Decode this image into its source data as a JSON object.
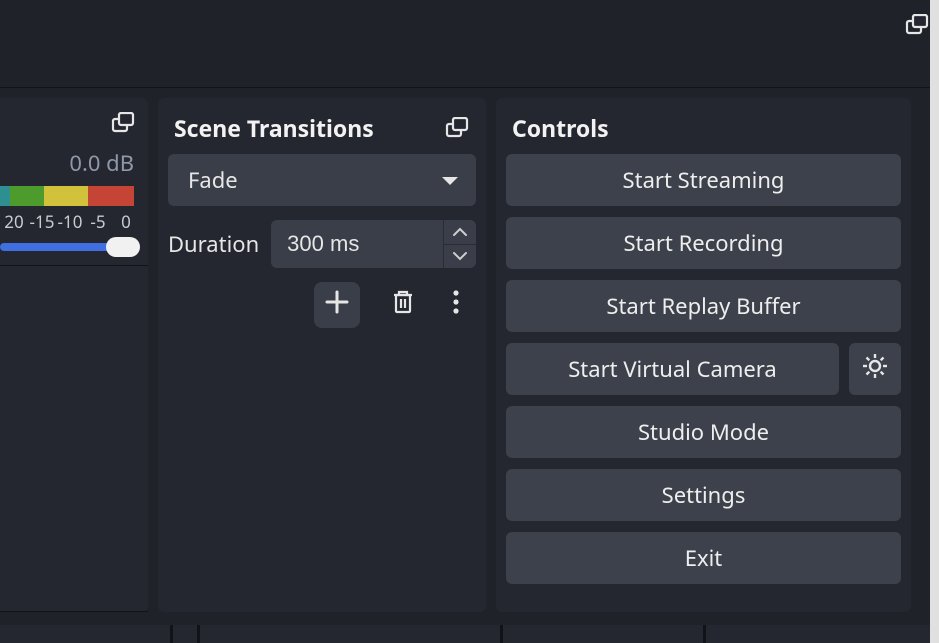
{
  "mixer": {
    "db_value": "0.0 dB",
    "tick_labels": [
      "20",
      "-15",
      "-10",
      "-5",
      "0"
    ]
  },
  "transitions": {
    "title": "Scene Transitions",
    "selected": "Fade",
    "duration_label": "Duration",
    "duration_value": "300 ms"
  },
  "controls": {
    "title": "Controls",
    "buttons": {
      "start_streaming": "Start Streaming",
      "start_recording": "Start Recording",
      "start_replay_buffer": "Start Replay Buffer",
      "start_virtual_camera": "Start Virtual Camera",
      "studio_mode": "Studio Mode",
      "settings": "Settings",
      "exit": "Exit"
    }
  }
}
